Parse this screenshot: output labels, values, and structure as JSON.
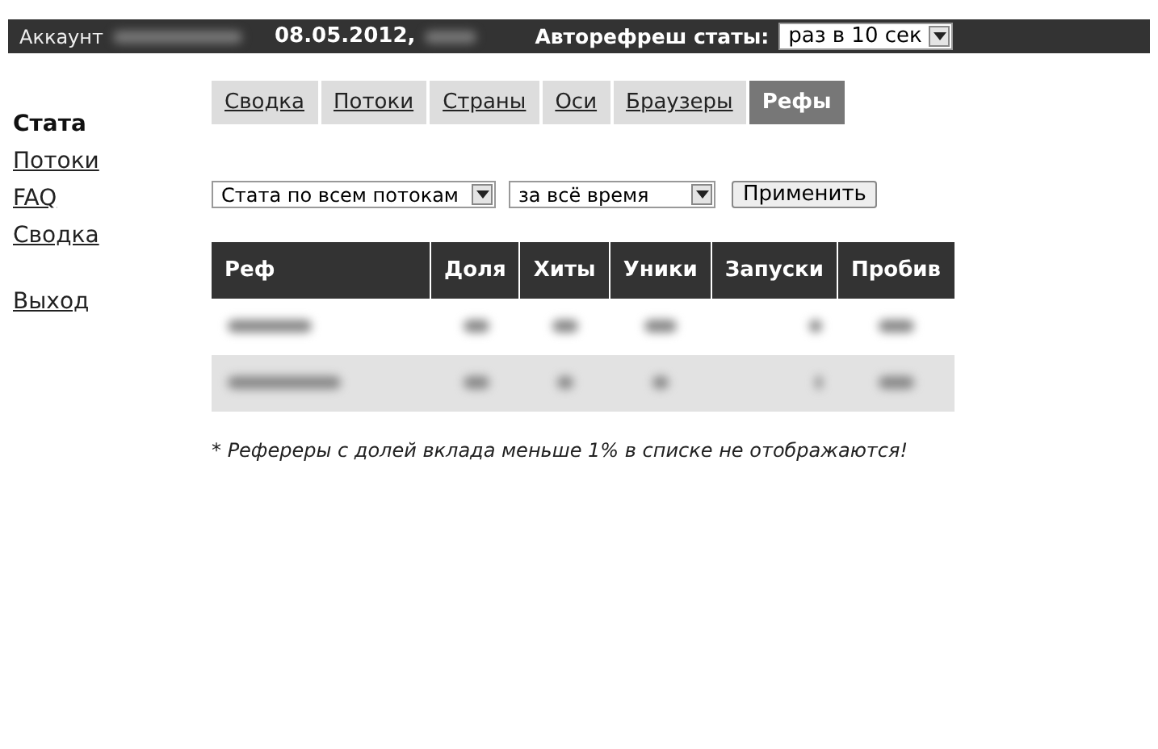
{
  "top_bar": {
    "account_label": "Аккаунт",
    "date": "08.05.2012,",
    "autorefresh_label": "Авторефреш статы:",
    "autorefresh_select": "раз в 10 сек"
  },
  "sidebar": {
    "items": [
      {
        "label": "Стата",
        "selected": true,
        "kind": "link"
      },
      {
        "label": "Потоки",
        "selected": false,
        "kind": "link"
      },
      {
        "label": "FAQ",
        "selected": false,
        "kind": "link"
      },
      {
        "label": "Сводка",
        "selected": false,
        "kind": "link"
      },
      {
        "label": "Выход",
        "selected": false,
        "kind": "exit"
      }
    ]
  },
  "tabs": [
    {
      "label": "Сводка",
      "selected": false
    },
    {
      "label": "Потоки",
      "selected": false
    },
    {
      "label": "Страны",
      "selected": false
    },
    {
      "label": "Оси",
      "selected": false
    },
    {
      "label": "Браузеры",
      "selected": false
    },
    {
      "label": "Рефы",
      "selected": true
    }
  ],
  "filters": {
    "stream_select": "Стата по всем потокам",
    "period_select": "за всё время",
    "apply_button": "Применить"
  },
  "table": {
    "columns": [
      "Реф",
      "Доля",
      "Хиты",
      "Уники",
      "Запуски",
      "Пробив"
    ],
    "rows": [
      {
        "kind": "redacted"
      },
      {
        "kind": "redacted"
      }
    ]
  },
  "footnote": "* Рефереры с долей вклада меньше 1% в списке не отображаются!"
}
